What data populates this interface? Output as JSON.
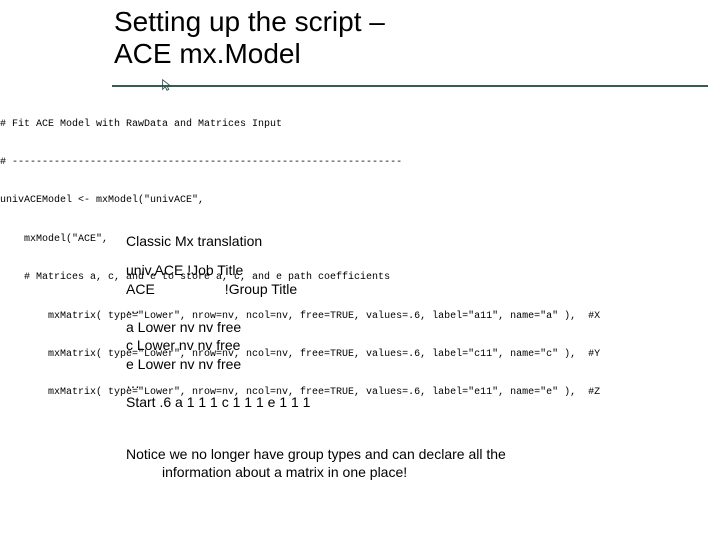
{
  "title_line1": "Setting up the script –",
  "title_line2": "ACE mx.Model",
  "code": {
    "l1": "# Fit ACE Model with RawData and Matrices Input",
    "l2": "# -----------------------------------------------------------------",
    "l3": "univACEModel <- mxModel(\"univACE\",",
    "l4": "    mxModel(\"ACE\",",
    "l5": "    # Matrices a, c, and e to store a, c, and e path coefficients",
    "l6": "        mxMatrix( type=\"Lower\", nrow=nv, ncol=nv, free=TRUE, values=.6, label=\"a11\", name=\"a\" ),  #X",
    "l7": "        mxMatrix( type=\"Lower\", nrow=nv, ncol=nv, free=TRUE, values=.6, label=\"c11\", name=\"c\" ),  #Y",
    "l8": "        mxMatrix( type=\"Lower\", nrow=nv, ncol=nv, free=TRUE, values=.6, label=\"e11\", name=\"e\" ),  #Z"
  },
  "body": {
    "heading": "Classic Mx translation",
    "mx": "univ.ACE !Job Title\nACE                  !Group Title\n…\na Lower nv nv free\nc Lower nv nv free\ne Lower nv nv free\n…\nStart .6 a 1 1 1 c 1 1 1 e 1 1 1"
  },
  "note_line1": "Notice we no longer have group types and can declare all the",
  "note_line2": "information about a matrix in one place!",
  "icon": "cursor-pointer-icon"
}
